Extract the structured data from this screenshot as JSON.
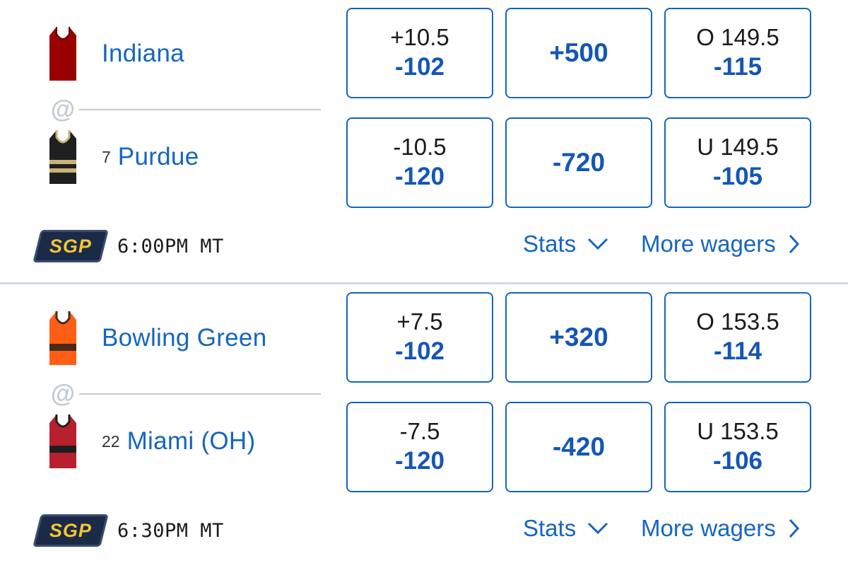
{
  "games": [
    {
      "away": {
        "name": "Indiana",
        "rank": "",
        "jersey": "indiana-jersey"
      },
      "home": {
        "name": "Purdue",
        "rank": "7",
        "jersey": "purdue-jersey"
      },
      "separator": "@",
      "spread": {
        "away_line": "+10.5",
        "away_price": "-102",
        "home_line": "-10.5",
        "home_price": "-120"
      },
      "moneyline": {
        "away": "+500",
        "home": "-720"
      },
      "total": {
        "over_line": "O 149.5",
        "over_price": "-115",
        "under_line": "U 149.5",
        "under_price": "-105"
      },
      "badge": "SGP",
      "time": "6:00PM MT",
      "stats_label": "Stats",
      "more_label": "More wagers"
    },
    {
      "away": {
        "name": "Bowling Green",
        "rank": "",
        "jersey": "bowling-green-jersey"
      },
      "home": {
        "name": "Miami (OH)",
        "rank": "22",
        "jersey": "miami-oh-jersey"
      },
      "separator": "@",
      "spread": {
        "away_line": "+7.5",
        "away_price": "-102",
        "home_line": "-7.5",
        "home_price": "-120"
      },
      "moneyline": {
        "away": "+320",
        "home": "-420"
      },
      "total": {
        "over_line": "O 153.5",
        "over_price": "-114",
        "under_line": "U 153.5",
        "under_price": "-106"
      },
      "badge": "SGP",
      "time": "6:30PM MT",
      "stats_label": "Stats",
      "more_label": "More wagers"
    }
  ],
  "colors": {
    "accent_blue": "#1565c0",
    "odds_price_blue": "#1456b5",
    "sgp_badge_bg": "#1b2a47",
    "sgp_badge_text": "#f2c534",
    "separator_gray": "#c3cad1"
  }
}
